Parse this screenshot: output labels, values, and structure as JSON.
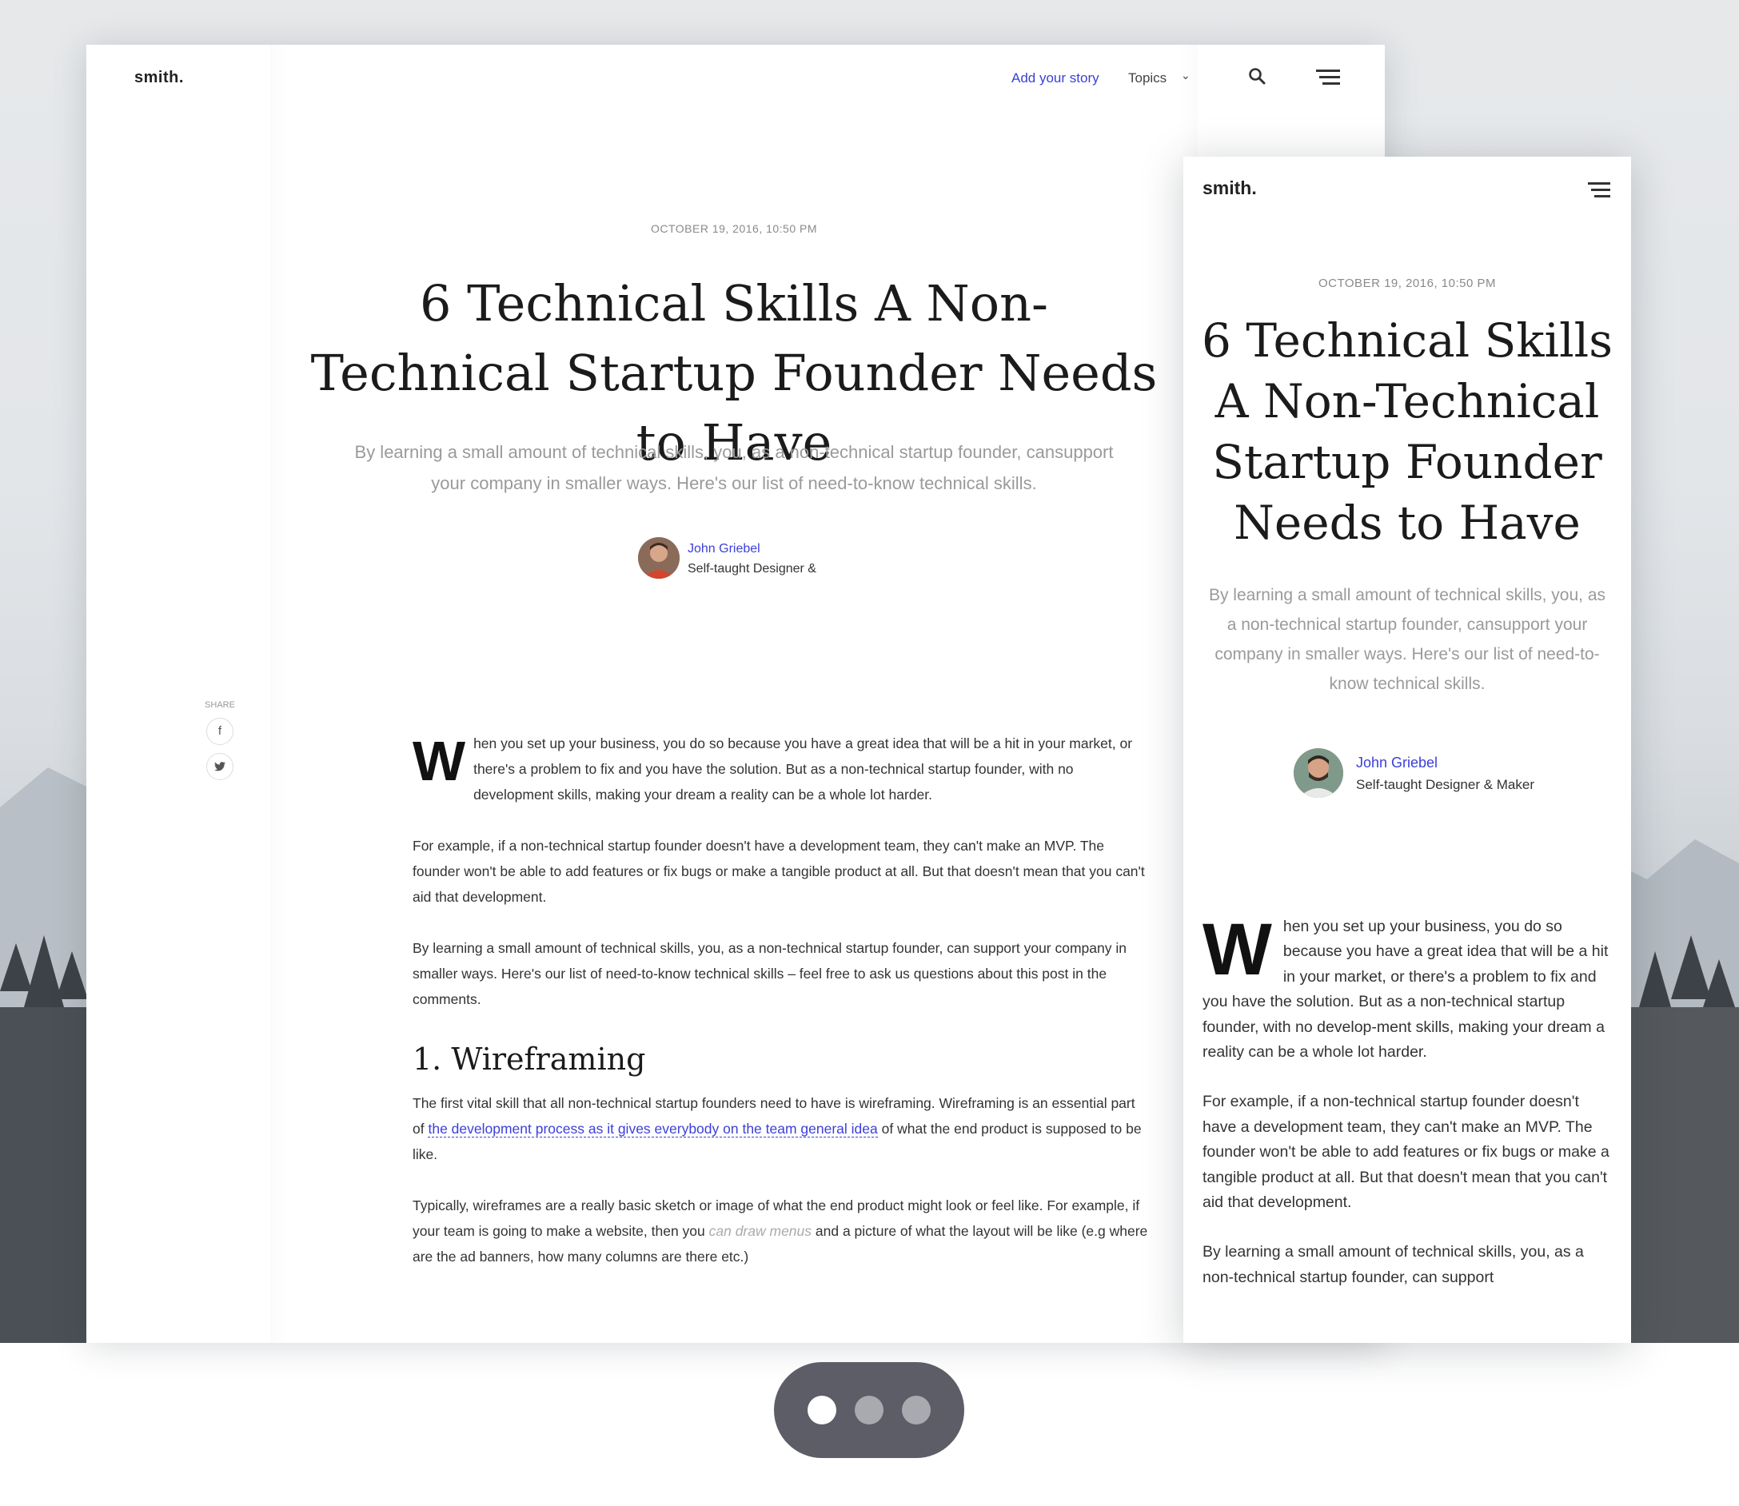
{
  "desktop": {
    "logo": "smith.",
    "nav": {
      "add_story": "Add your story",
      "topics": "Topics"
    },
    "date": "OCTOBER 19, 2016, 10:50 PM",
    "title": "6 Technical Skills A Non-Technical Startup Founder Needs to Have",
    "lead": "By learning a small amount of technical skills, you, as a non-technical startup founder, cansupport your company in smaller ways. Here's our list of need-to-know technical skills.",
    "author": {
      "name": "John Griebel",
      "role": "Self-taught Designer &"
    },
    "share_label": "SHARE",
    "body": {
      "p1_cap": "W",
      "p1": "hen you set up your business, you do so because you have a great idea that will be a hit in your market, or there's a problem to fix and you have the solution. But as a non-technical startup founder, with no development skills, making your dream a reality can be a whole lot harder.",
      "p2": "For example, if a non-technical startup founder doesn't have a development team, they can't make an MVP. The founder won't be able to add features or fix bugs or make a tangible product at all. But that doesn't mean that you can't aid that development.",
      "p3": "By learning a small amount of technical skills, you, as a non-technical startup founder, can support your company in smaller ways. Here's our list of need-to-know technical skills – feel free to ask us questions about this post in the comments.",
      "h2": "1. Wireframing",
      "p4_a": "The first vital skill that all non-technical startup founders need to have is wireframing. Wireframing is an essential part of ",
      "p4_link": "the development process as it gives everybody on the team general idea",
      "p4_b": " of what the end product is supposed to be like.",
      "p5_a": "Typically, wireframes are a really basic sketch or image of what the end product might look or feel like. For example, if your team is going to make a website, then you ",
      "p5_muted": "can draw menus",
      "p5_b": " and a picture of what the layout will be like (e.g where are the ad banners, how many columns are there etc.)"
    }
  },
  "mobile": {
    "logo": "smith.",
    "date": "OCTOBER 19, 2016, 10:50 PM",
    "title": "6 Technical Skills A Non-Technical Startup Founder Needs to Have",
    "lead": "By learning a small amount of technical skills, you, as a non-technical startup founder, cansupport your company in smaller ways. Here's our list of need-to-know technical skills.",
    "author": {
      "name": "John Griebel",
      "role": "Self-taught Designer & Maker"
    },
    "body": {
      "p1_cap": "W",
      "p1": "hen you set up your business, you do so because you have a great idea that will be a hit in your market, or there's a problem to fix and you have the solution. But as a non-technical startup founder, with no develop-ment skills, making your dream a reality can be a whole lot harder.",
      "p2": "For example, if a non-technical startup founder doesn't have a development team, they can't make an MVP. The founder won't be able to add features or fix bugs or make a tangible product at all. But that doesn't mean that you can't aid that development.",
      "p3": "By learning a small amount of technical skills, you, as a non-technical startup founder, can support"
    }
  },
  "carousel": {
    "active_index": 0,
    "count": 3
  },
  "colors": {
    "accent": "#3b3fd8",
    "text": "#333333",
    "muted": "#9a9a9a",
    "pill": "#5c5d66"
  },
  "icons": [
    "search-icon",
    "hamburger-menu-icon",
    "chevron-down-icon",
    "facebook-icon",
    "twitter-icon"
  ]
}
